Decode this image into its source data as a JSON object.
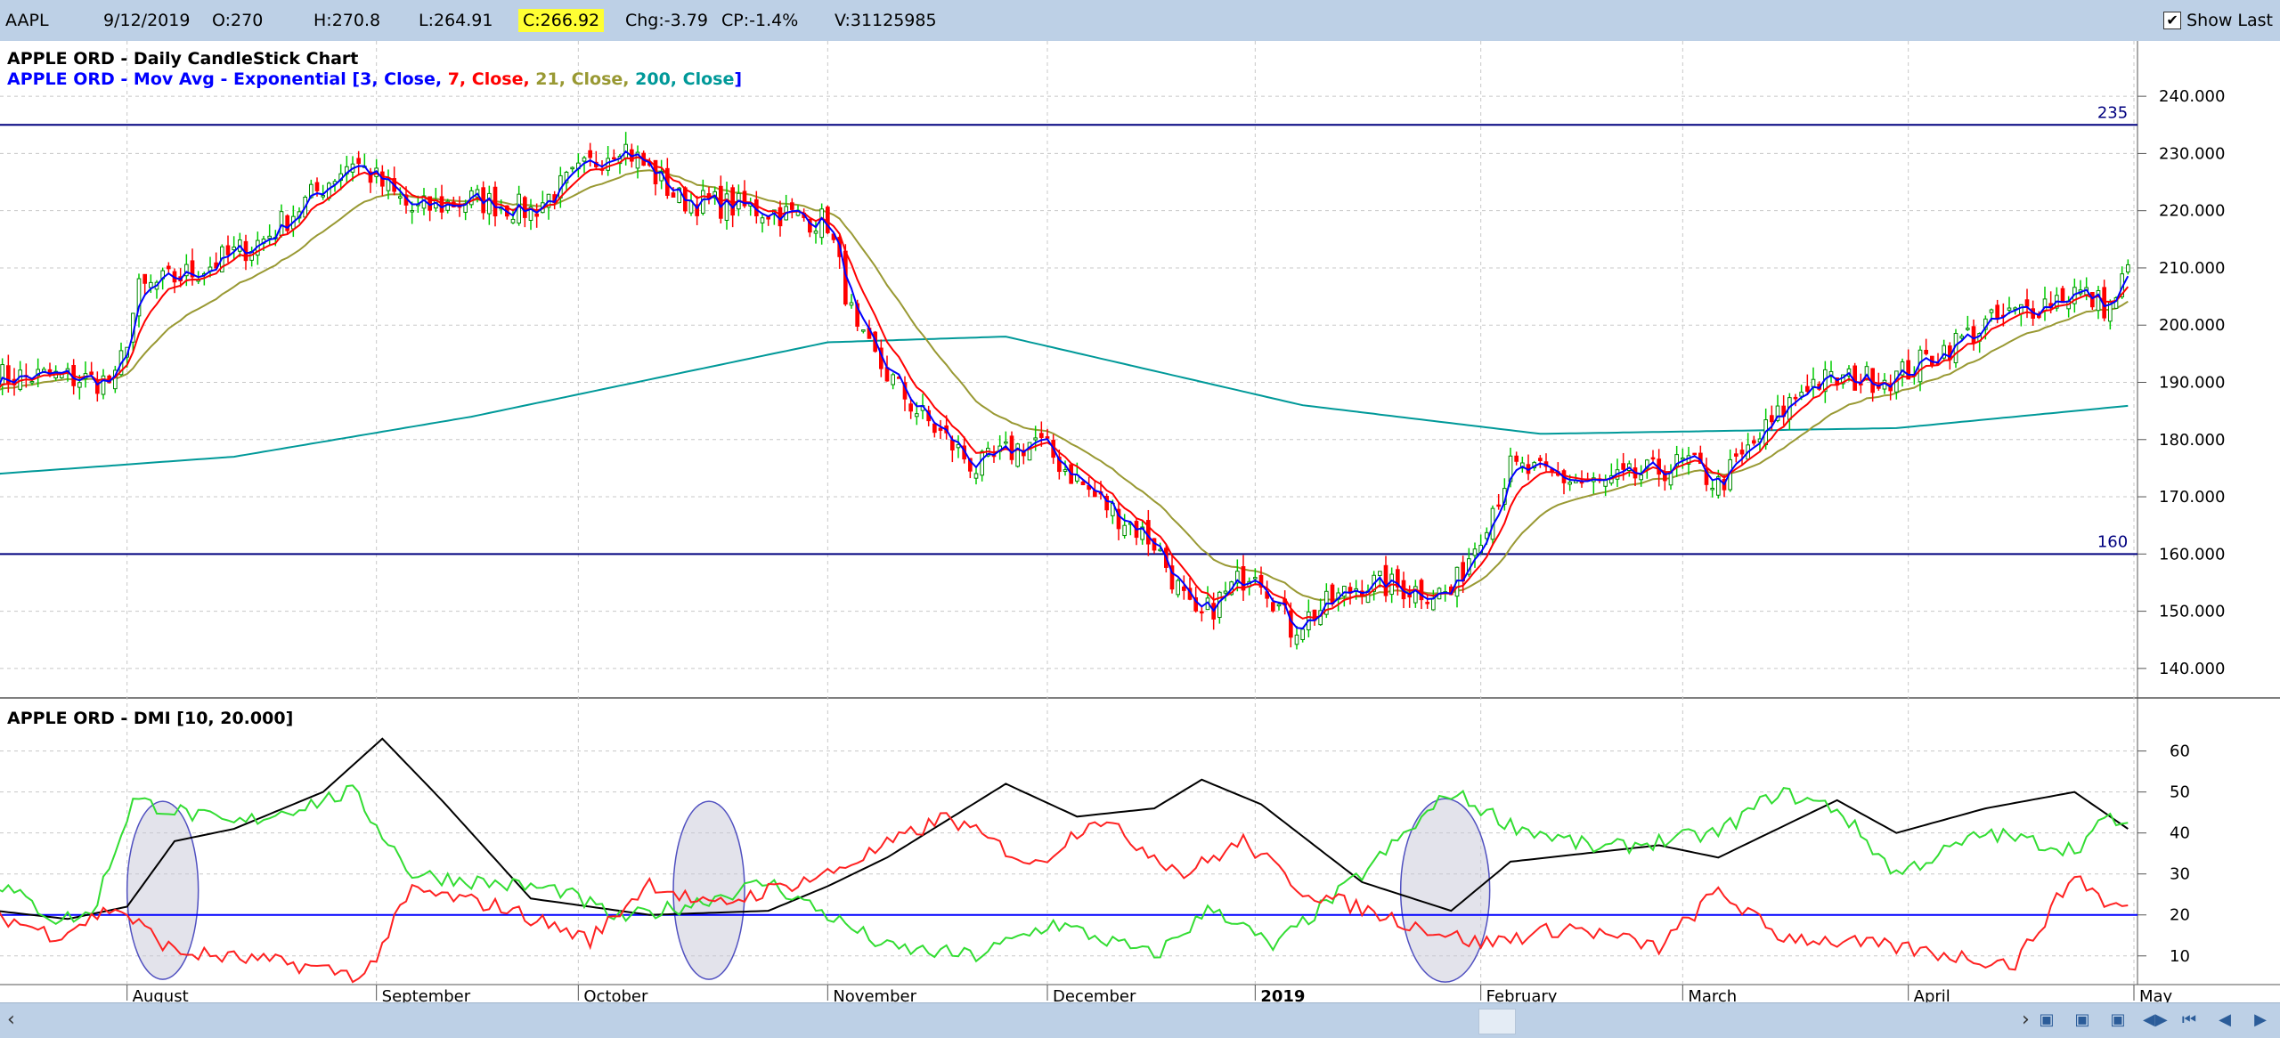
{
  "topbar": {
    "symbol": "AAPL",
    "date": "9/12/2019",
    "open": "O:270",
    "high": "H:270.8",
    "low": "L:264.91",
    "close": "C:266.92",
    "change": "Chg:-3.79",
    "change_pct": "CP:-1.4%",
    "volume": "V:31125985",
    "show_last_label": "Show Last",
    "show_last_checked": true
  },
  "colors": {
    "up_candle": "#00cc00",
    "down_candle": "#ff0000",
    "ema3": "#0000ff",
    "ema7": "#ff0000",
    "ema21": "#999933",
    "ema200": "#009999",
    "di_plus": "#33dd33",
    "di_minus": "#ff2222",
    "adx": "#000000",
    "hline": "#00007f",
    "ellipse_fill": "#c8c8d8"
  },
  "chart_data": [
    {
      "type": "candlestick",
      "title": "APPLE ORD - Daily CandleStick Chart",
      "overlay_title": {
        "prefix": "APPLE ORD - Mov Avg - Exponential [",
        "parts": [
          {
            "text": "3",
            "color": "#0000ff"
          },
          {
            "text": ", Close, ",
            "color": "#0000ff"
          },
          {
            "text": "7",
            "color": "#ff0000"
          },
          {
            "text": ", Close, ",
            "color": "#ff0000"
          },
          {
            "text": "21",
            "color": "#999933"
          },
          {
            "text": ", Close, ",
            "color": "#999933"
          },
          {
            "text": "200",
            "color": "#009999"
          },
          {
            "text": ", Close",
            "color": "#009999"
          }
        ],
        "suffix": "]"
      },
      "ylim": [
        135,
        245
      ],
      "yticks": [
        "140.000",
        "150.000",
        "160.000",
        "170.000",
        "180.000",
        "190.000",
        "200.000",
        "210.000",
        "220.000",
        "230.000",
        "240.000"
      ],
      "yticks_values": [
        140,
        150,
        160,
        170,
        180,
        190,
        200,
        210,
        220,
        230,
        240
      ],
      "horizontal_lines": [
        {
          "value": 235,
          "label": "235"
        },
        {
          "value": 160,
          "label": "160"
        }
      ],
      "ema200_anchors": [
        [
          0,
          174
        ],
        [
          40,
          177
        ],
        [
          80,
          184
        ],
        [
          140,
          197
        ],
        [
          170,
          198
        ],
        [
          220,
          186
        ],
        [
          260,
          181
        ],
        [
          320,
          182
        ],
        [
          360,
          186
        ]
      ],
      "price_anchors": [
        [
          0,
          191
        ],
        [
          10,
          191
        ],
        [
          20,
          190
        ],
        [
          24,
          206
        ],
        [
          35,
          210
        ],
        [
          45,
          215
        ],
        [
          60,
          229
        ],
        [
          70,
          220
        ],
        [
          80,
          222
        ],
        [
          90,
          220
        ],
        [
          105,
          232
        ],
        [
          115,
          222
        ],
        [
          130,
          220
        ],
        [
          140,
          218
        ],
        [
          145,
          198
        ],
        [
          155,
          185
        ],
        [
          165,
          175
        ],
        [
          175,
          180
        ],
        [
          185,
          170
        ],
        [
          195,
          162
        ],
        [
          202,
          148
        ],
        [
          212,
          158
        ],
        [
          218,
          147
        ],
        [
          230,
          155
        ],
        [
          245,
          153
        ],
        [
          255,
          175
        ],
        [
          270,
          172
        ],
        [
          285,
          176
        ],
        [
          290,
          172
        ],
        [
          305,
          190
        ],
        [
          320,
          191
        ],
        [
          335,
          200
        ],
        [
          350,
          206
        ],
        [
          356,
          203
        ],
        [
          360,
          212
        ]
      ]
    },
    {
      "type": "line",
      "title": "APPLE ORD - DMI [10, 20.000]",
      "ylim": [
        3,
        66
      ],
      "yticks": [
        "10",
        "20",
        "30",
        "40",
        "50",
        "60"
      ],
      "yticks_values": [
        10,
        20,
        30,
        40,
        50,
        60
      ],
      "horizontal_lines": [
        {
          "value": 20,
          "label": ""
        }
      ],
      "series": [
        {
          "id": "adx",
          "color": "#000000",
          "anchors": [
            [
              0,
              21
            ],
            [
              12,
              19
            ],
            [
              22,
              22
            ],
            [
              30,
              38
            ],
            [
              40,
              41
            ],
            [
              55,
              50
            ],
            [
              65,
              63
            ],
            [
              75,
              48
            ],
            [
              90,
              24
            ],
            [
              100,
              22
            ],
            [
              110,
              20
            ],
            [
              130,
              21
            ],
            [
              140,
              27
            ],
            [
              150,
              34
            ],
            [
              170,
              52
            ],
            [
              182,
              44
            ],
            [
              195,
              46
            ],
            [
              203,
              53
            ],
            [
              213,
              47
            ],
            [
              230,
              28
            ],
            [
              245,
              21
            ],
            [
              255,
              33
            ],
            [
              280,
              37
            ],
            [
              290,
              34
            ],
            [
              310,
              48
            ],
            [
              320,
              40
            ],
            [
              335,
              46
            ],
            [
              350,
              50
            ],
            [
              360,
              40
            ]
          ]
        },
        {
          "id": "di_plus",
          "color": "#33dd33",
          "anchors": [
            [
              0,
              28
            ],
            [
              10,
              19
            ],
            [
              16,
              20
            ],
            [
              23,
              48
            ],
            [
              40,
              42
            ],
            [
              60,
              50
            ],
            [
              70,
              30
            ],
            [
              82,
              28
            ],
            [
              95,
              26
            ],
            [
              105,
              19
            ],
            [
              115,
              22
            ],
            [
              130,
              28
            ],
            [
              150,
              12
            ],
            [
              165,
              10
            ],
            [
              178,
              18
            ],
            [
              195,
              10
            ],
            [
              205,
              22
            ],
            [
              215,
              12
            ],
            [
              230,
              30
            ],
            [
              245,
              50
            ],
            [
              255,
              42
            ],
            [
              270,
              36
            ],
            [
              290,
              40
            ],
            [
              300,
              50
            ],
            [
              310,
              46
            ],
            [
              320,
              30
            ],
            [
              335,
              40
            ],
            [
              350,
              36
            ],
            [
              356,
              44
            ],
            [
              360,
              40
            ]
          ]
        },
        {
          "id": "di_minus",
          "color": "#ff2222",
          "anchors": [
            [
              0,
              20
            ],
            [
              10,
              15
            ],
            [
              20,
              22
            ],
            [
              30,
              11
            ],
            [
              50,
              8
            ],
            [
              62,
              5
            ],
            [
              70,
              26
            ],
            [
              85,
              22
            ],
            [
              100,
              14
            ],
            [
              110,
              28
            ],
            [
              120,
              22
            ],
            [
              140,
              30
            ],
            [
              160,
              44
            ],
            [
              175,
              32
            ],
            [
              185,
              44
            ],
            [
              200,
              30
            ],
            [
              210,
              38
            ],
            [
              220,
              26
            ],
            [
              240,
              17
            ],
            [
              250,
              13
            ],
            [
              265,
              17
            ],
            [
              280,
              12
            ],
            [
              290,
              26
            ],
            [
              300,
              15
            ],
            [
              320,
              12
            ],
            [
              340,
              8
            ],
            [
              350,
              30
            ],
            [
              356,
              22
            ],
            [
              360,
              22
            ]
          ]
        }
      ]
    }
  ],
  "x_axis": {
    "labels": [
      "August",
      "September",
      "October",
      "November",
      "December",
      "2019",
      "February",
      "March",
      "April",
      "May"
    ],
    "label_bars": [
      22,
      64,
      98,
      140,
      177,
      212,
      250,
      284,
      322,
      360
    ],
    "bold_index": 5,
    "bars": 360
  }
}
